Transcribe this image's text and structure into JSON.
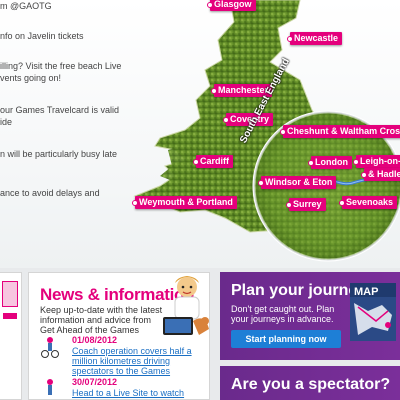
{
  "tweets": [
    {
      "text": "m @GAOTG"
    },
    {
      "text": "nfo on Javelin tickets"
    },
    {
      "text": "illing? Visit the free beach Live"
    },
    {
      "text": "vents going on!"
    },
    {
      "text": "our Games Travelcard is valid"
    },
    {
      "text": "ide"
    },
    {
      "text": "n will be particularly busy late"
    },
    {
      "text": "ance to avoid delays and"
    }
  ],
  "map": {
    "region_label": "South East England",
    "pins": [
      {
        "id": "glasgow",
        "label": "Glasgow"
      },
      {
        "id": "newcastle",
        "label": "Newcastle"
      },
      {
        "id": "manchester",
        "label": "Manchester"
      },
      {
        "id": "coventry",
        "label": "Coventry"
      },
      {
        "id": "cardiff",
        "label": "Cardiff"
      },
      {
        "id": "weymouth",
        "label": "Weymouth & Portland"
      },
      {
        "id": "cheshunt",
        "label": "Cheshunt & Waltham Cross"
      },
      {
        "id": "london",
        "label": "London"
      },
      {
        "id": "leigh",
        "label": "Leigh-on-Se"
      },
      {
        "id": "hadleigh",
        "label": "& Hadleigh"
      },
      {
        "id": "windsor",
        "label": "Windsor & Eton"
      },
      {
        "id": "sevenoaks",
        "label": "Sevenoaks"
      },
      {
        "id": "surrey",
        "label": "Surrey"
      }
    ]
  },
  "news": {
    "title": "News & information",
    "description": "Keep up-to-date with the latest information and advice from Get Ahead of the Games",
    "items": [
      {
        "date": "01/08/2012",
        "headline": "Coach operation covers half a million kilometres driving spectators to the Games"
      },
      {
        "date": "30/07/2012",
        "headline": "Head to a Live Site to watch"
      }
    ]
  },
  "plan": {
    "title": "Plan your journey",
    "description": "Don't get caught out. Plan your journeys in advance.",
    "button_label": "Start planning now",
    "book_label": "MAP"
  },
  "spectator": {
    "title": "Are you a spectator?"
  },
  "colors": {
    "accent": "#e4007c",
    "purple": "#6d2a8e",
    "link": "#1a6fc4",
    "button": "#1e7fd6"
  }
}
